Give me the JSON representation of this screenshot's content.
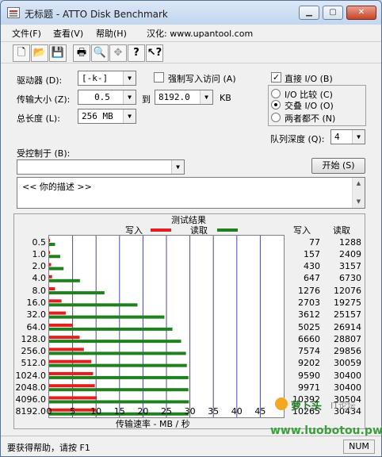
{
  "window": {
    "title": "无标题 - ATTO Disk Benchmark"
  },
  "menu": [
    "文件(F)",
    "查看(V)",
    "帮助(H)",
    "汉化: www.upantool.com"
  ],
  "toolbar_icons": [
    "new-file-icon",
    "open-folder-icon",
    "save-icon",
    "print-icon",
    "print-preview-icon",
    "move-icon",
    "help-icon",
    "context-help-icon"
  ],
  "form": {
    "drive_label": "驱动器 (D):",
    "drive_value": "[-k-]",
    "transfer_size_label": "传输大小 (Z):",
    "transfer_from": "0.5",
    "to_label": "到",
    "transfer_to": "8192.0",
    "kb_unit": "KB",
    "total_length_label": "总长度 (L):",
    "total_length_value": "256 MB",
    "force_write_label": "强制写入访问 (A)",
    "direct_io_label": "直接 I/O (B)",
    "io_compare_label": "I/O 比较 (C)",
    "overlapped_io_label": "交叠 I/O (O)",
    "neither_label": "两者都不 (N)",
    "queue_depth_label": "队列深度 (Q):",
    "queue_depth_value": "4",
    "controlled_by_label": "受控制于 (B):",
    "start_button": "开始 (S)",
    "description": "<<  你的描述   >>"
  },
  "results": {
    "title": "测试结果",
    "legend_write": "写入",
    "legend_read": "读取",
    "col_write": "写入",
    "col_read": "读取"
  },
  "chart_data": {
    "type": "bar",
    "orientation": "horizontal",
    "title": "测试结果",
    "xlabel": "传输速率 - MB / 秒",
    "xlim": [
      0,
      50
    ],
    "xticks": [
      0,
      5,
      10,
      15,
      20,
      25,
      30,
      35,
      40,
      45
    ],
    "grid": true,
    "legend_position": "top",
    "colors": {
      "write": "#e02020",
      "read": "#208020"
    },
    "categories": [
      "0.5",
      "1.0",
      "2.0",
      "4.0",
      "8.0",
      "16.0",
      "32.0",
      "64.0",
      "128.0",
      "256.0",
      "512.0",
      "1024.0",
      "2048.0",
      "4096.0",
      "8192.0"
    ],
    "series": [
      {
        "name": "写入",
        "values": [
          0.08,
          0.15,
          0.42,
          0.63,
          1.25,
          2.64,
          3.53,
          4.91,
          6.5,
          7.4,
          8.99,
          9.37,
          9.74,
          10.15,
          10.02
        ]
      },
      {
        "name": "读取",
        "values": [
          1.26,
          2.35,
          3.08,
          6.57,
          11.79,
          18.82,
          24.57,
          26.28,
          28.13,
          29.16,
          29.35,
          29.69,
          29.69,
          29.79,
          29.72
        ]
      }
    ],
    "table": {
      "write_kb": [
        "77",
        "157",
        "430",
        "647",
        "1276",
        "2703",
        "3612",
        "5025",
        "6660",
        "7574",
        "9202",
        "9590",
        "9971",
        "10392",
        "10265"
      ],
      "read_kb": [
        "1288",
        "2409",
        "3157",
        "6730",
        "12076",
        "19275",
        "25157",
        "26914",
        "28807",
        "29856",
        "30059",
        "30400",
        "30400",
        "30504",
        "30434"
      ]
    }
  },
  "status": {
    "help_text": "要获得帮助，请按 F1",
    "num_indicator": "NUM"
  },
  "watermark": {
    "brand": "萝卜头IT论坛",
    "url": "www.luobotou.pw"
  }
}
